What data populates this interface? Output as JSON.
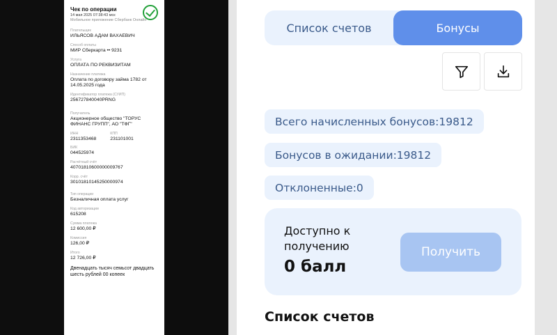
{
  "receipt": {
    "title": "Чек по операции",
    "datetime": "14 мая 2025 07:38:43 мск",
    "app": "Мобильное приложение Сбербанк Онлайн",
    "payer_label": "Плательщик",
    "payer": "ИЛЬЯСОВ АДАМ ВАХАЕВИЧ",
    "method_label": "Способ оплаты",
    "method": "МИР Сберкарта •• 9231",
    "service_label": "Услуга",
    "service": "ОПЛАТА ПО РЕКВИЗИТАМ",
    "purpose_label": "Назначение платежа",
    "purpose": "Оплата по договору займа 1782 от 14.05.2025 года",
    "suip_label": "Идентификатор платежа (СУИП)",
    "suip": "256727840040PRNG",
    "recipient_label": "Получатель",
    "recipient": "Акционерное общество \"ТОРУС ФИНАНС ГРУПП\", АО \"ТФГ\"",
    "inn_label": "ИНН",
    "inn": "2311353468",
    "kpp_label": "КПП",
    "kpp": "231101001",
    "bik_label": "БИК",
    "bik": "044525974",
    "account_label": "Расчётный счёт",
    "account": "40701810600000009767",
    "corr_label": "Корр. счёт",
    "corr": "30101810145250000974",
    "op_type_label": "Тип операции",
    "op_type": "Безналичная оплата услуг",
    "auth_label": "Код авторизации",
    "auth": "615208",
    "amount_label": "Сумма платежа",
    "amount": "12 600,00 ₽",
    "fee_label": "Комиссия",
    "fee": "126,00 ₽",
    "total_label": "Итого",
    "total": "12 726,00 ₽",
    "total_words": "Двенадцать тысяч семьсот двадцать шесть рублей 00 копеек"
  },
  "tabs": {
    "accounts": "Список счетов",
    "bonuses": "Бонусы",
    "active": "bonuses"
  },
  "stats": {
    "total": "Всего начисленных бонусов:19812",
    "pending": "Бонусов в ожидании:19812",
    "rejected": "Отклоненные:0"
  },
  "card": {
    "label": "Доступно к получению",
    "amount": "0 балл",
    "button": "Получить"
  },
  "section_title": "Список счетов",
  "icons": {
    "filter": "filter-icon",
    "download": "download-icon",
    "check": "check-circle-icon"
  },
  "colors": {
    "accent": "#5f8fea",
    "light": "#eaf2fd",
    "text": "#3a5a8a",
    "disabled_button": "#a8c5f2",
    "sber_green": "#21a038"
  }
}
